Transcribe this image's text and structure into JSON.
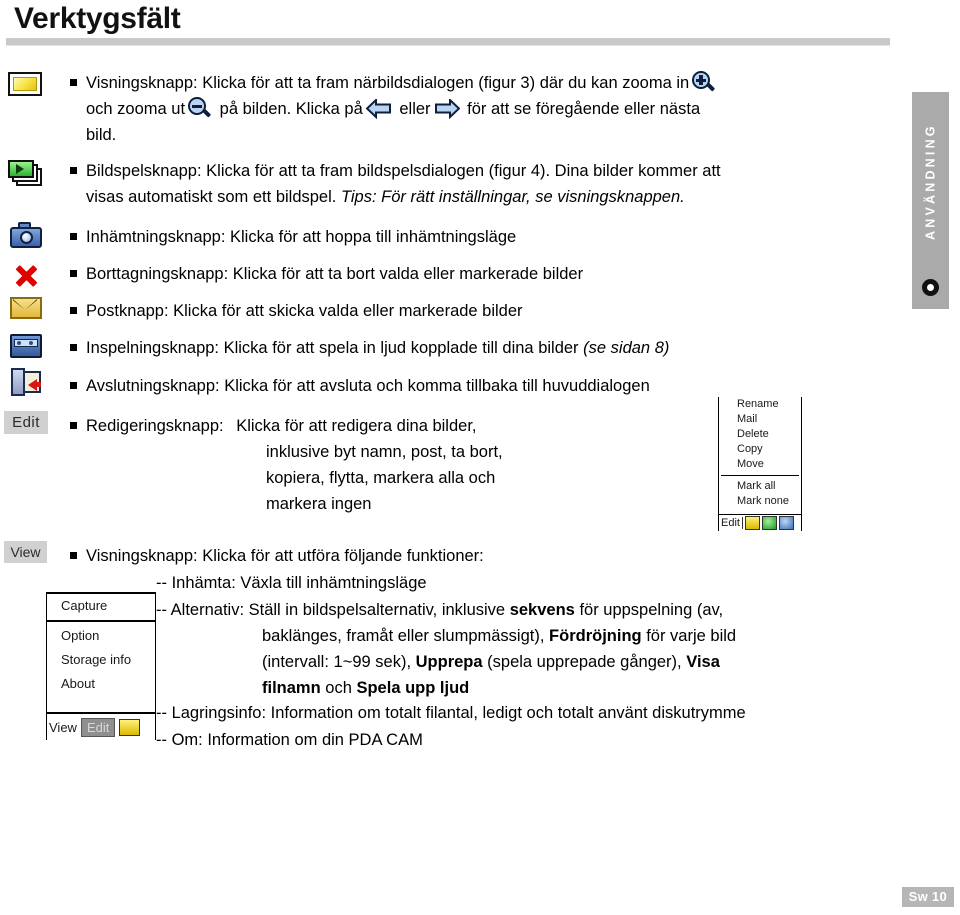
{
  "page": {
    "title": "Verktygsfält",
    "footer_page_label": "Sw 10",
    "side_tab_label": "ANVÄNDNING"
  },
  "items": {
    "view_button": {
      "icon_name": "view-button-icon",
      "lead": "Visningsknapp:",
      "text_1": "Klicka för att ta fram närbildsdialogen (figur 3) där du kan zooma in",
      "text_2a": "och zooma ut",
      "text_2b": "på bilden. Klicka på",
      "text_2c": "eller",
      "text_2d": "för att se föregående eller nästa",
      "text_3": "bild."
    },
    "slideshow_button": {
      "icon_name": "slideshow-button-icon",
      "lead": "Bildspelsknapp:",
      "text_1": "Klicka för att ta fram bildspelsdialogen (figur 4). Dina bilder kommer att",
      "text_2": "visas automatiskt som ett bildspel.",
      "tip": "Tips: För rätt inställningar, se visningsknappen."
    },
    "capture_button": {
      "icon_name": "camera-button-icon",
      "text": "Inhämtningsknapp: Klicka för att hoppa till inhämtningsläge"
    },
    "delete_button": {
      "icon_name": "delete-button-icon",
      "text": "Borttagningsknapp: Klicka för att ta bort valda eller markerade bilder"
    },
    "mail_button": {
      "icon_name": "mail-button-icon",
      "text": "Postknapp: Klicka för att skicka valda eller markerade bilder"
    },
    "record_button": {
      "icon_name": "record-button-icon",
      "text": "Inspelningsknapp: Klicka för att spela in ljud kopplade till dina bilder",
      "text_italic": "(se sidan 8)"
    },
    "exit_button": {
      "icon_name": "exit-button-icon",
      "text": "Avslutningsknapp: Klicka för att avsluta och komma tillbaka till huvuddialogen"
    },
    "edit_button": {
      "icon_name": "edit-button-icon",
      "icon_label": "Edit",
      "lead": "Redigeringsknapp:",
      "line_1": "Klicka för att redigera dina bilder,",
      "line_2": "inklusive byt namn, post, ta bort,",
      "line_3": "kopiera, flytta, markera alla och",
      "line_4": "markera ingen"
    },
    "view_menu_button": {
      "icon_name": "view-menu-button-icon",
      "icon_label": "View",
      "text": "Visningsknapp: Klicka för att utföra följande funktioner:",
      "sub_capture": "-- Inhämta: Växla till inhämtningsläge",
      "sub_option_1a": "-- Alternativ: Ställ in bildspelsalternativ, inklusive",
      "sub_option_1b": "sekvens",
      "sub_option_1c": "för uppspelning (av,",
      "sub_option_2a": "baklänges, framåt eller slumpmässigt),",
      "sub_option_2b": "Fördröjning",
      "sub_option_2c": "för varje bild",
      "sub_option_3a": "(intervall: 1~99 sek),",
      "sub_option_3b": "Upprepa",
      "sub_option_3c": "(spela upprepade gånger),",
      "sub_option_3d": "Visa",
      "sub_option_4a": "filnamn",
      "sub_option_4b": "och",
      "sub_option_4c": "Spela upp ljud",
      "sub_storage": "-- Lagringsinfo: Information om totalt filantal, ledigt och totalt använt diskutrymme",
      "sub_about": "-- Om: Information om din PDA CAM"
    }
  },
  "edit_context_menu": {
    "items": [
      "Rename",
      "Mail",
      "Delete",
      "Copy",
      "Move"
    ],
    "items_group2": [
      "Mark all",
      "Mark none"
    ],
    "tray_label": "Edit"
  },
  "view_context_menu": {
    "item_capture": "Capture",
    "items_group2": [
      "Option",
      "Storage info",
      "About"
    ],
    "tray_label_view": "View",
    "tray_label_edit": "Edit"
  },
  "colors": {
    "rule": "#c9c9c9",
    "side_tab": "#aaaaaa",
    "footer_badge": "#b6b6b6"
  }
}
